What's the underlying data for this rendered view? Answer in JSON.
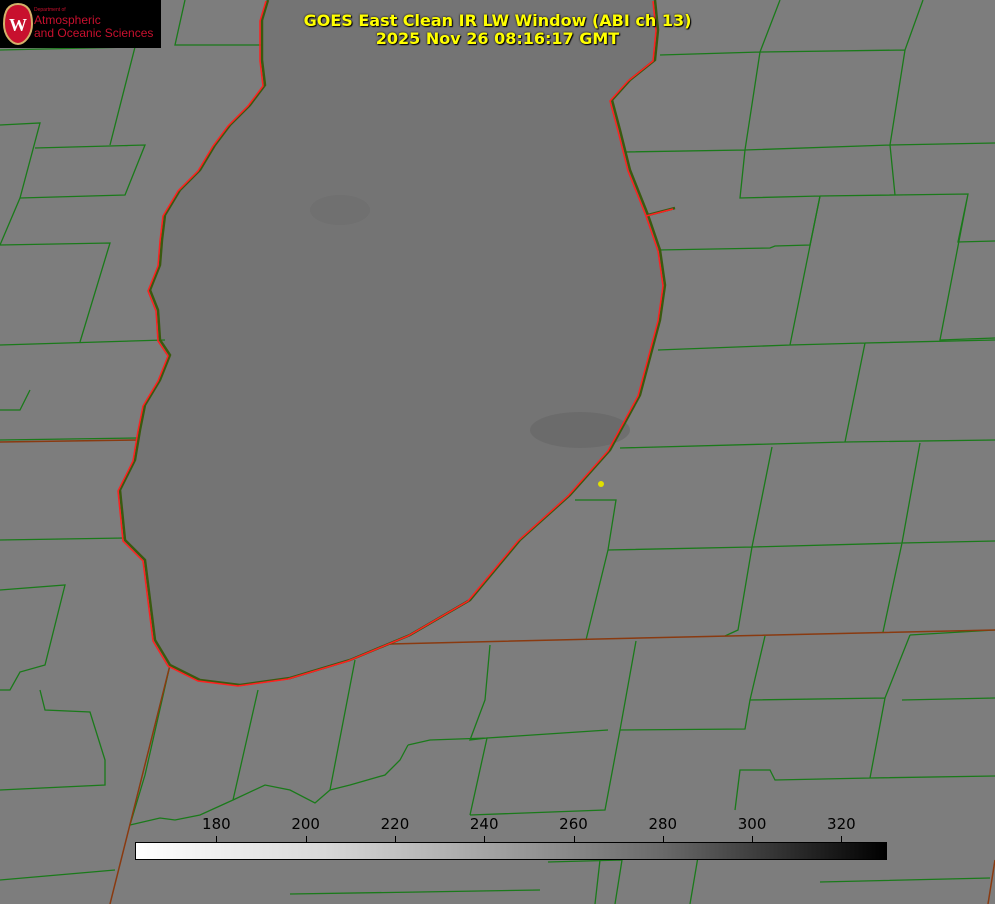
{
  "title": {
    "line1": "GOES East Clean IR LW Window (ABI ch 13)",
    "line2": "2025 Nov 26 08:16:17 GMT"
  },
  "logo": {
    "small": "Department of",
    "line1": "Atmospheric",
    "line2": "and Oceanic Sciences",
    "letter": "W"
  },
  "colorbar": {
    "min": 162,
    "max": 330,
    "ticks": [
      "180",
      "200",
      "220",
      "240",
      "260",
      "280",
      "300",
      "320"
    ],
    "colormap": "white-to-black"
  },
  "colors": {
    "title": "#ffff00",
    "coastline": "#ff2020",
    "county_lines": "#1a7a1a",
    "marker": "#e0e000"
  }
}
